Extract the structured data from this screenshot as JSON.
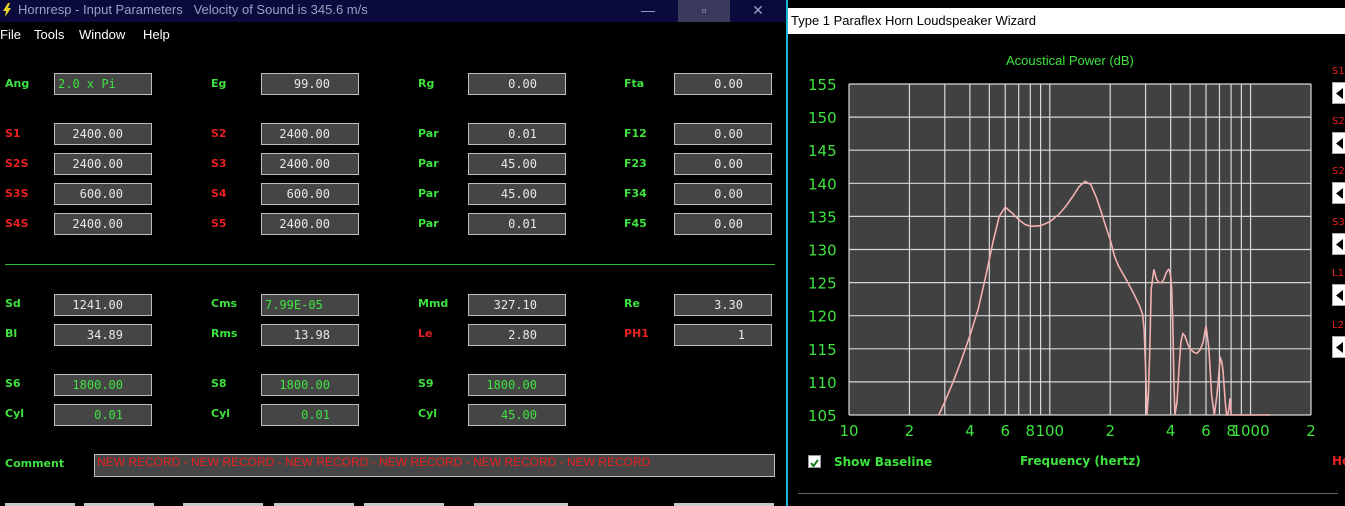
{
  "left_window": {
    "title": "Hornresp - Input Parameters   Velocity of Sound is 345.6 m/s",
    "minimize": "—",
    "maximize": "▫",
    "close": "✕",
    "menu": [
      "File",
      "Tools",
      "Window",
      "Help"
    ],
    "rows": [
      {
        "label": "Ang",
        "color": "g",
        "value": "2.0 x Pi",
        "label2": "Eg",
        "value2": "99.00",
        "label3": "Rg",
        "value3": "0.00",
        "label4": "Fta",
        "value4": "0.00"
      },
      {
        "label": "S1",
        "color": "r",
        "value": "2400.00",
        "label2": "S2",
        "value2": "2400.00",
        "label3": "Par",
        "value3": "0.01",
        "label4": "F12",
        "value4": "0.00"
      },
      {
        "label": "S2S",
        "color": "r",
        "value": "2400.00",
        "label2": "S3",
        "value2": "2400.00",
        "label3": "Par",
        "value3": "45.00",
        "label4": "F23",
        "value4": "0.00"
      },
      {
        "label": "S3S",
        "color": "r",
        "value": "600.00",
        "label2": "S4",
        "value2": "600.00",
        "label3": "Par",
        "value3": "45.00",
        "label4": "F34",
        "value4": "0.00"
      },
      {
        "label": "S4S",
        "color": "r",
        "value": "2400.00",
        "label2": "S5",
        "value2": "2400.00",
        "label3": "Par",
        "value3": "0.01",
        "label4": "F45",
        "value4": "0.00"
      }
    ],
    "driver": {
      "sd_label": "Sd",
      "sd": "1241.00",
      "cms_label": "Cms",
      "cms": "7.99E-05",
      "mmd_label": "Mmd",
      "mmd": "327.10",
      "re_label": "Re",
      "re": "3.30",
      "bl_label": "Bl",
      "bl": "34.89",
      "rms_label": "Rms",
      "rms": "13.98",
      "le_label": "Le",
      "le": "2.80",
      "ph1_label": "PH1",
      "ph1": "1"
    },
    "chambers": {
      "s6_label": "S6",
      "s6": "1800.00",
      "s8_label": "S8",
      "s8": "1800.00",
      "s9_label": "S9",
      "s9": "1800.00",
      "cyl1_label": "Cyl",
      "cyl1": "0.01",
      "cyl2_label": "Cyl",
      "cyl2": "0.01",
      "cyl3_label": "Cyl",
      "cyl3": "45.00"
    },
    "comment_label": "Comment",
    "comment": "NEW RECORD - NEW RECORD - NEW RECORD - NEW RECORD - NEW RECORD - NEW RECORD"
  },
  "right_window": {
    "title": "Type 1 Paraflex Horn Loudspeaker Wizard",
    "show_baseline": "Show Baseline",
    "baseline_checked": true,
    "freq_axis_label": "Frequency (hertz)",
    "edge_label": "Ho",
    "side_labels": [
      "S1",
      "S2",
      "S2",
      "S3",
      "L1",
      "L2"
    ]
  },
  "chart_data": {
    "type": "line",
    "title": "Acoustical Power (dB)",
    "xlabel": "Frequency (hertz)",
    "ylabel": "",
    "x_scale": "log",
    "xlim": [
      10,
      2000
    ],
    "ylim": [
      105,
      155
    ],
    "y_ticks": [
      105,
      110,
      115,
      120,
      125,
      130,
      135,
      140,
      145,
      150,
      155
    ],
    "x_tick_labels": [
      "10",
      "2",
      "4",
      "6",
      "8",
      "100",
      "2",
      "4",
      "6",
      "8",
      "1000",
      "2"
    ],
    "grid": true,
    "line_color": "#f2b0b0",
    "series": [
      {
        "x": [
          28,
          30,
          33,
          36,
          40,
          44,
          48,
          52,
          56,
          60,
          65,
          70,
          75,
          80,
          90,
          100,
          110,
          120,
          130,
          140,
          150,
          160,
          170,
          180,
          190,
          200,
          210,
          220,
          240,
          260,
          280,
          290,
          295,
          300,
          305,
          310,
          315,
          320,
          330,
          340,
          350,
          360,
          370,
          380,
          390,
          395,
          400,
          405,
          410,
          415,
          420,
          430,
          440,
          450,
          460,
          470,
          480,
          490,
          500,
          520,
          540,
          560,
          580,
          600,
          620,
          640,
          660,
          680,
          690,
          700,
          710,
          720,
          730,
          740,
          750,
          760,
          770,
          780,
          790,
          800,
          820,
          840,
          860,
          880,
          900,
          920,
          940,
          960,
          980,
          1000,
          1050,
          1100,
          1150,
          1200,
          1250
        ],
        "y": [
          105,
          107,
          110,
          113,
          117,
          121,
          126,
          131,
          135,
          136.4,
          135.5,
          134.5,
          133.8,
          133.5,
          133.6,
          134.2,
          135.2,
          136.5,
          138,
          139.5,
          140.3,
          139.8,
          138,
          135.8,
          133.5,
          131.5,
          129,
          127.5,
          125.5,
          123.5,
          121.5,
          120.2,
          118,
          112,
          105,
          108,
          115,
          124,
          127,
          125.5,
          125,
          125,
          125.5,
          126.5,
          127,
          126.8,
          126,
          124,
          119,
          110,
          105,
          107,
          112,
          116,
          117.3,
          117,
          116.2,
          115.5,
          115,
          114.5,
          114.3,
          114.8,
          116,
          118.5,
          115,
          108,
          105,
          108,
          110,
          112.5,
          113.5,
          113,
          111.5,
          109,
          106.5,
          105,
          105,
          106,
          107.5,
          105,
          105,
          105,
          105,
          105,
          105,
          105,
          105,
          105,
          105,
          105,
          105,
          105,
          105,
          105,
          105
        ],
        "note": ""
      }
    ]
  }
}
